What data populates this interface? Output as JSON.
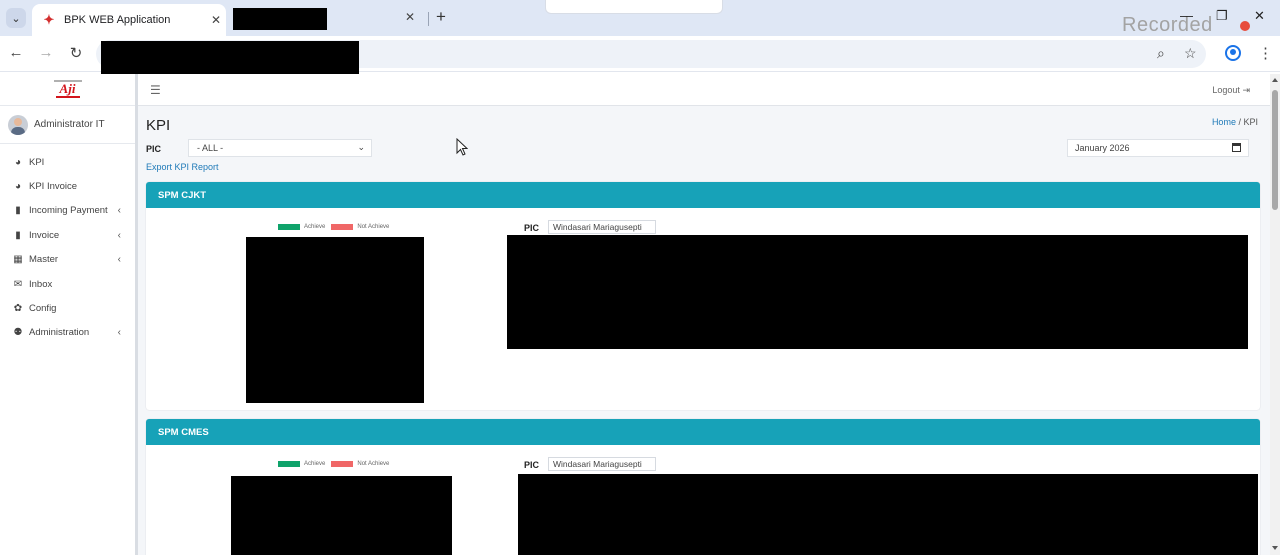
{
  "browser": {
    "tab_title": "BPK WEB Application",
    "recorded_label": "Recorded",
    "window_controls": {
      "minimize": "—",
      "restore": "❐",
      "close": "✕"
    }
  },
  "sidebar": {
    "user_name": "Administrator IT",
    "items": [
      {
        "label": "KPI",
        "icon": "pie-chart-icon",
        "glyph": "◕",
        "caret": false
      },
      {
        "label": "KPI Invoice",
        "icon": "pie-chart-icon",
        "glyph": "◕",
        "caret": false
      },
      {
        "label": "Incoming Payment",
        "icon": "file-icon",
        "glyph": "▮",
        "caret": true
      },
      {
        "label": "Invoice",
        "icon": "file-icon",
        "glyph": "▮",
        "caret": true
      },
      {
        "label": "Master",
        "icon": "table-icon",
        "glyph": "▦",
        "caret": true
      },
      {
        "label": "Inbox",
        "icon": "envelope-icon",
        "glyph": "✉",
        "caret": false
      },
      {
        "label": "Config",
        "icon": "gear-icon",
        "glyph": "✿",
        "caret": false
      },
      {
        "label": "Administration",
        "icon": "user-cog-icon",
        "glyph": "⚉",
        "caret": true
      }
    ]
  },
  "header": {
    "logout_label": "Logout"
  },
  "page": {
    "title": "KPI",
    "breadcrumb_home": "Home",
    "breadcrumb_current": "KPI",
    "pic_label": "PIC",
    "pic_selected": "- ALL -",
    "export_label": "Export KPI Report",
    "period_value": "January 2026"
  },
  "legend": {
    "achieve_label": "Achieve",
    "not_achieve_label": "Not Achieve",
    "achieve_color": "#0fa36b",
    "not_achieve_color": "#f06767"
  },
  "cards": [
    {
      "title": "SPM CJKT",
      "pic_label": "PIC",
      "pic_value": "Windasari Mariagusepti"
    },
    {
      "title": "SPM CMES",
      "pic_label": "PIC",
      "pic_value": "Windasari Mariagusepti"
    }
  ],
  "colors": {
    "accent": "#17a2b8",
    "link": "#1f7ab8",
    "recording_dot": "#e74c3c"
  }
}
